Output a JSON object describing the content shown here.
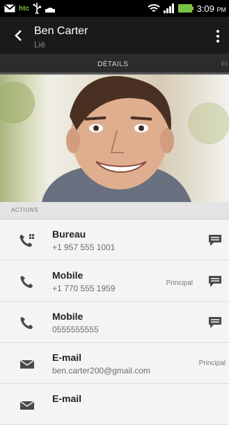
{
  "status_bar": {
    "time": "3:09",
    "ampm": "PM",
    "icons": [
      "gmail-icon",
      "htc-icon",
      "usb-icon",
      "android-icon",
      "wifi-icon",
      "signal-icon",
      "battery-icon"
    ],
    "carrier": "htc"
  },
  "header": {
    "contact_name": "Ben Carter",
    "subtitle": "Lié"
  },
  "tabs": {
    "active": "DÉTAILS",
    "next_partial": "FI"
  },
  "section": {
    "title": "ACTIONS"
  },
  "actions": [
    {
      "type": "phone-work-icon",
      "label": "Bureau",
      "value": "+1 957 555 1001",
      "primary": "",
      "message": true
    },
    {
      "type": "phone-icon",
      "label": "Mobile",
      "value": "+1 770 555 1959",
      "primary": "Principal",
      "message": true
    },
    {
      "type": "phone-icon",
      "label": "Mobile",
      "value": "0555555555",
      "primary": "",
      "message": true
    },
    {
      "type": "envelope-icon",
      "label": "E-mail",
      "value": "ben.carter200@gmail.com",
      "primary": "Principal",
      "message": false
    },
    {
      "type": "envelope-icon",
      "label": "E-mail",
      "value": "",
      "primary": "",
      "message": false
    }
  ],
  "colors": {
    "status_bar": "#000000",
    "app_bar": "#1a1a1a",
    "tab_bar": "#2c2c2c",
    "list_background": "#f4f4f4",
    "htc_green": "#7cc242"
  }
}
